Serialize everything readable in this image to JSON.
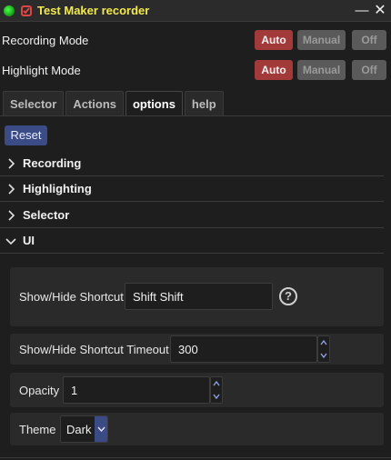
{
  "window": {
    "title": "Test Maker recorder",
    "minimize_glyph": "—",
    "close_glyph": "✕"
  },
  "modes": {
    "recording": {
      "label": "Recording Mode",
      "selected": "Auto",
      "options": [
        "Auto",
        "Manual",
        "Off"
      ]
    },
    "highlight": {
      "label": "Highlight Mode",
      "selected": "Auto",
      "options": [
        "Auto",
        "Manual",
        "Off"
      ]
    }
  },
  "tabs": [
    {
      "label": "Selector",
      "active": false
    },
    {
      "label": "Actions",
      "active": false
    },
    {
      "label": "options",
      "active": true
    },
    {
      "label": "help",
      "active": false
    }
  ],
  "reset_label": "Reset",
  "sections": [
    {
      "label": "Recording",
      "expanded": false
    },
    {
      "label": "Highlighting",
      "expanded": false
    },
    {
      "label": "Selector",
      "expanded": false
    },
    {
      "label": "UI",
      "expanded": true
    }
  ],
  "ui_settings": {
    "shortcut": {
      "label": "Show/Hide Shortcut",
      "value": "Shift Shift",
      "help_glyph": "?"
    },
    "timeout": {
      "label": "Show/Hide Shortcut Timeout",
      "value": "300"
    },
    "opacity": {
      "label": "Opacity",
      "value": "1"
    },
    "theme": {
      "label": "Theme",
      "value": "Dark"
    }
  },
  "colors": {
    "accent_active": "#a33a3a",
    "accent_blue": "#3b4b86",
    "title_text": "#f2e94e",
    "status_online": "#2ecc2e"
  },
  "icons": {
    "status": "status-dot-icon",
    "logo": "test-maker-logo-icon",
    "chevron_right": "chevron-right-icon",
    "chevron_down": "chevron-down-icon",
    "help": "help-circle-icon"
  }
}
